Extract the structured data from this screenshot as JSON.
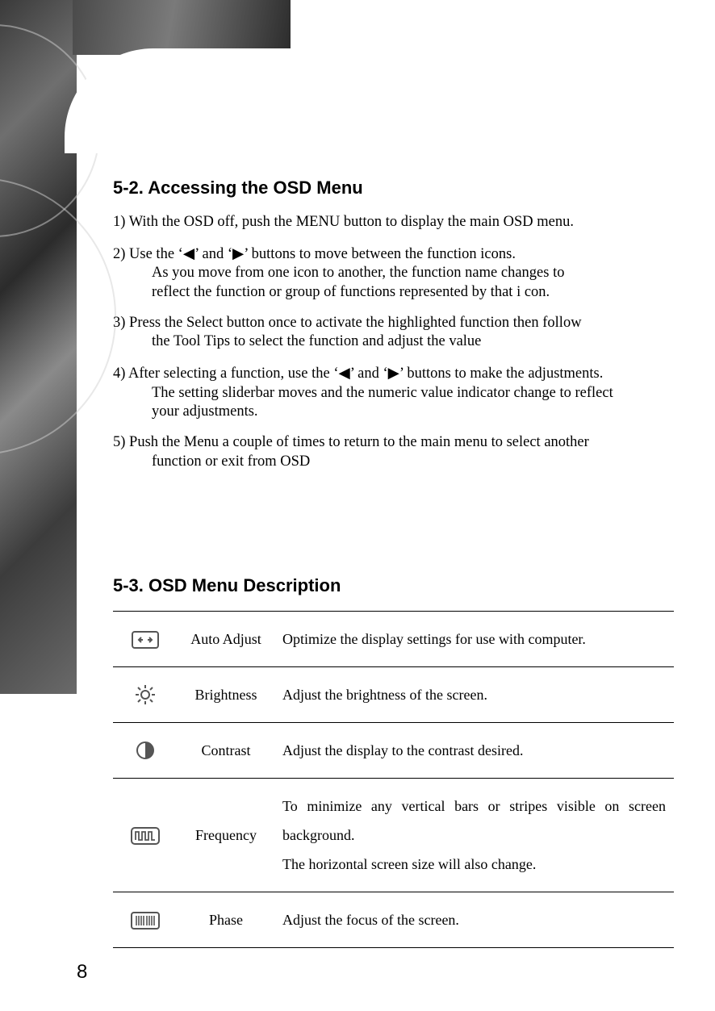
{
  "page_number": "8",
  "section_52": {
    "heading": "5-2.  Accessing the OSD Menu",
    "step1": "1) With the OSD off, push the MENU button to display the main OSD menu.",
    "step2_a": "2) Use the",
    "step2_b": "and",
    "step2_c": "buttons to move between the function icons.",
    "step2_line2": "As you move from one icon to another, the function name changes to",
    "step2_line3": "reflect the function or  group of functions represented by that i con.",
    "step3_a": "3) Press the Select button once to activate the highlighted function then follow",
    "step3_b": "the Tool Tips to select the function and adjust the value",
    "step4_a": "4) After selecting a function, use the",
    "step4_b": "and",
    "step4_c": "buttons to make the adjustments.",
    "step4_line2": "The setting sliderbar moves and the numeric value indicator change to reflect",
    "step4_line3": "your adjustments.",
    "step5_a": "5) Push the Menu a couple of times to return to the main menu to select another",
    "step5_b": "function or exit from OSD"
  },
  "section_53": {
    "heading": "5-3.  OSD  Menu Description",
    "rows": [
      {
        "icon": "auto-adjust-icon",
        "name": "Auto Adjust",
        "desc": "Optimize the display settings for use with computer."
      },
      {
        "icon": "brightness-icon",
        "name": "Brightness",
        "desc": "Adjust the brightness of the screen."
      },
      {
        "icon": "contrast-icon",
        "name": "Contrast",
        "desc": "Adjust the display to the contrast desired."
      },
      {
        "icon": "frequency-icon",
        "name": "Frequency",
        "desc": "To minimize any vertical bars or stripes visible on screen background.\nThe horizontal screen size will also change."
      },
      {
        "icon": "phase-icon",
        "name": "Phase",
        "desc": "Adjust the focus of the screen."
      }
    ]
  },
  "glyphs": {
    "left": "◀",
    "right": "▶",
    "lq": "‘",
    "rq": "’"
  }
}
